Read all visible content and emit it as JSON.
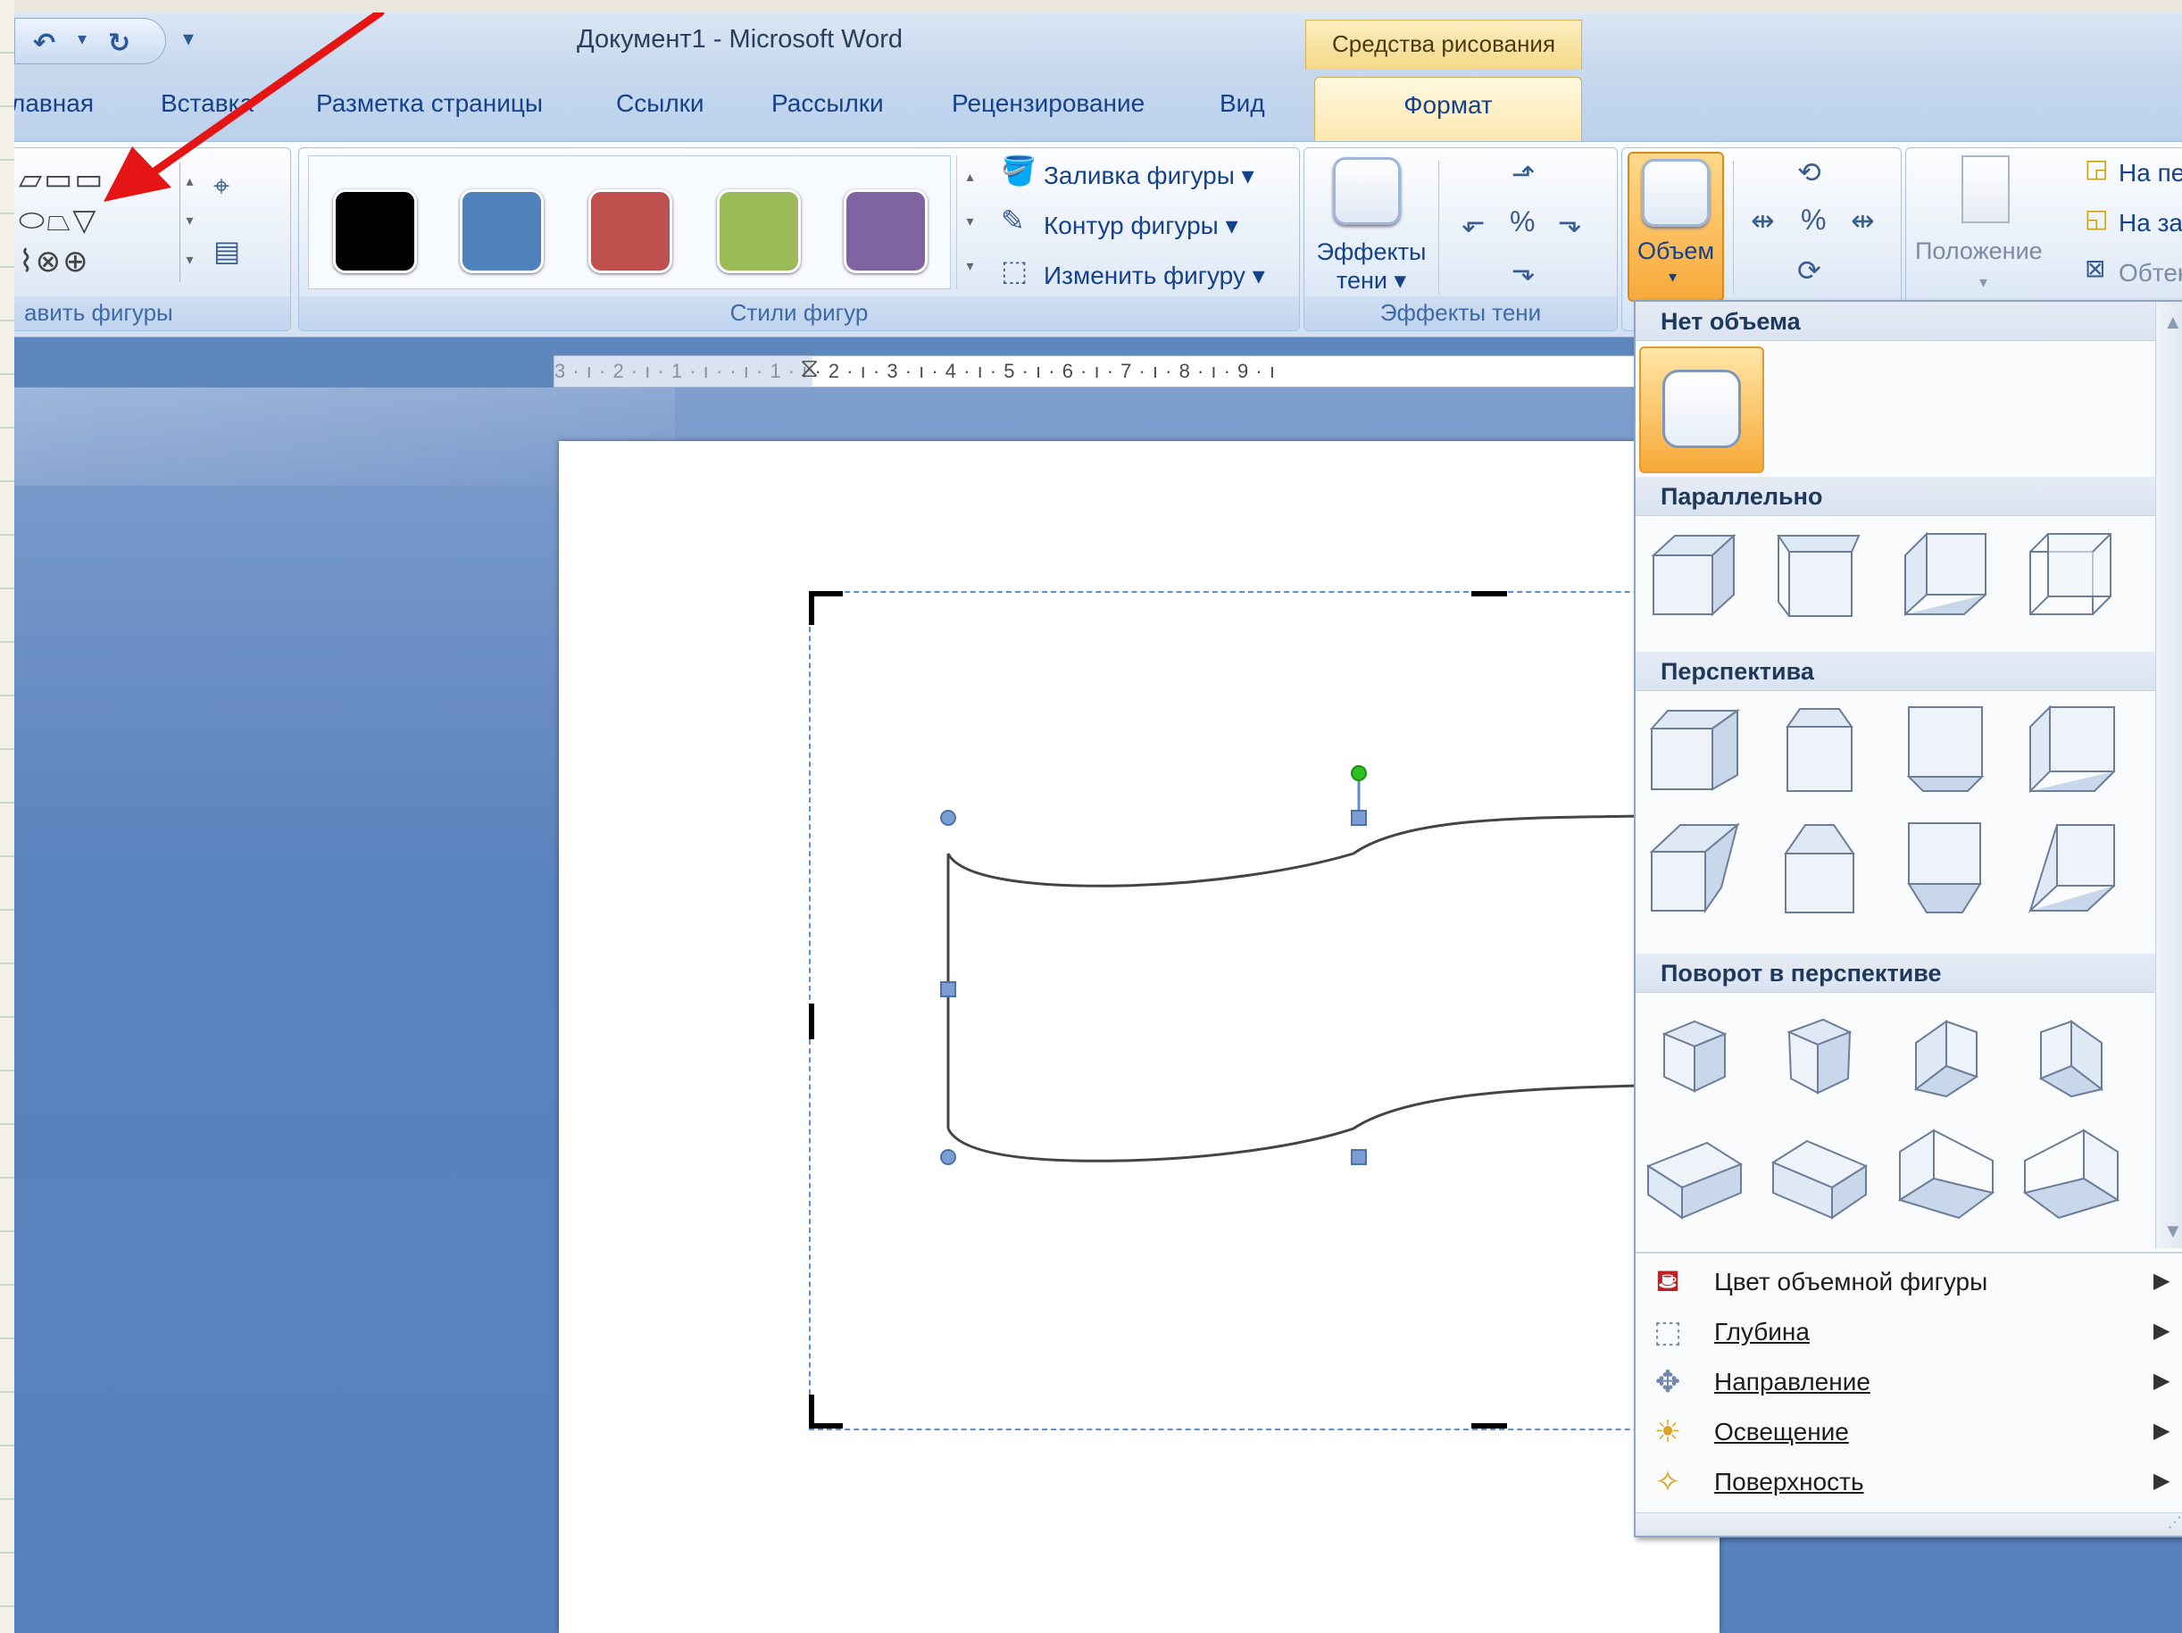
{
  "titlebar": {
    "document_title": "Документ1 - Microsoft Word",
    "context_tab": "Средства рисования",
    "undo_icon": "undo-icon",
    "redo_icon": "redo-icon",
    "qat_menu": "▾"
  },
  "tabs": {
    "home": "лавная",
    "insert": "Вставка",
    "layout": "Разметка страницы",
    "references": "Ссылки",
    "mailings": "Рассылки",
    "review": "Рецензирование",
    "view": "Вид",
    "format": "Формат"
  },
  "ribbon": {
    "insert_shapes_label": "авить фигуры",
    "shape_styles_label": "Стили фигур",
    "fill_label": "Заливка фигуры",
    "outline_label": "Контур фигуры",
    "change_shape_label": "Изменить фигуру",
    "shadow_btn_line1": "Эффекты",
    "shadow_btn_line2": "тени",
    "shadow_group_label": "Эффекты тени",
    "volume_btn": "Объем",
    "position_btn": "Положение",
    "bring_front": "На пе",
    "send_back": "На зад",
    "wrap": "Обтек",
    "swatch_colors": [
      "#000000",
      "#4f81bd",
      "#c0504d",
      "#9bbb59",
      "#8064a2"
    ]
  },
  "ruler": {
    "text": "3 · ı · 2 · ı · 1 · ı ·  · ı · 1 · ı · 2 · ı · 3 · ı · 4 · ı · 5 · ı · 6 · ı · 7 · ı · 8 · ı · 9 · ı"
  },
  "dropdown": {
    "no_volume_head": "Нет объема",
    "parallel_head": "Параллельно",
    "perspective_head": "Перспектива",
    "rotation_head": "Поворот в перспективе",
    "menu_items": [
      {
        "label": "Цвет объемной фигуры",
        "icon": "fill-bucket-icon"
      },
      {
        "label": "Глубина",
        "icon": "depth-icon"
      },
      {
        "label": "Направление",
        "icon": "direction-icon"
      },
      {
        "label": "Освещение",
        "icon": "lighting-icon"
      },
      {
        "label": "Поверхность",
        "icon": "surface-icon"
      }
    ]
  }
}
